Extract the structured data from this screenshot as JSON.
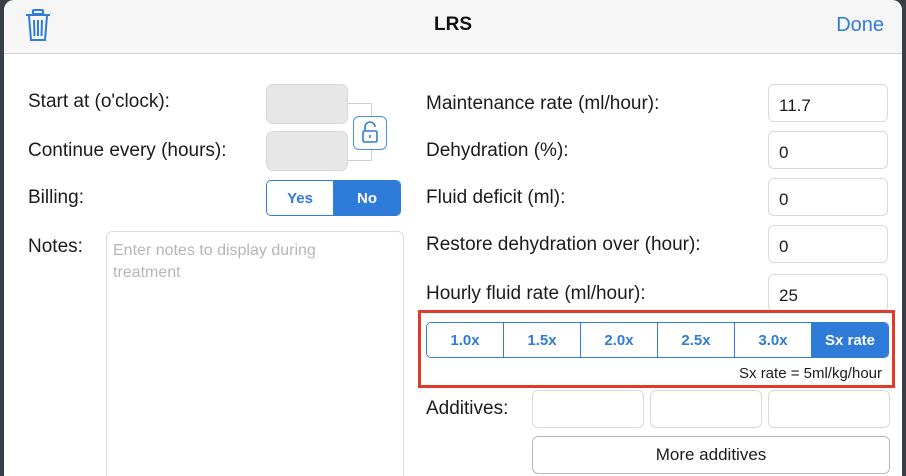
{
  "header": {
    "title": "LRS",
    "done_label": "Done"
  },
  "left": {
    "start_label": "Start at (o'clock):",
    "continue_label": "Continue every (hours):",
    "billing_label": "Billing:",
    "billing_options": [
      "Yes",
      "No"
    ],
    "billing_selected": "No",
    "notes_label": "Notes:",
    "notes_placeholder": "Enter notes to display during treatment"
  },
  "right": {
    "fields": [
      {
        "label": "Maintenance rate (ml/hour):",
        "value": "11.7"
      },
      {
        "label": "Dehydration (%):",
        "value": "0"
      },
      {
        "label": "Fluid deficit (ml):",
        "value": "0"
      },
      {
        "label": "Restore dehydration over (hour):",
        "value": "0"
      },
      {
        "label": "Hourly fluid rate (ml/hour):",
        "value": "25"
      }
    ],
    "rate_options": [
      "1.0x",
      "1.5x",
      "2.0x",
      "2.5x",
      "3.0x",
      "Sx rate"
    ],
    "rate_selected": "Sx rate",
    "rate_note": "Sx rate = 5ml/kg/hour",
    "additives_label": "Additives:",
    "more_additives_label": "More additives"
  },
  "icons": {
    "trash": "trash-icon",
    "lock": "unlock-icon"
  },
  "colors": {
    "accent": "#2f7bd9",
    "highlight": "#e03a2a"
  }
}
